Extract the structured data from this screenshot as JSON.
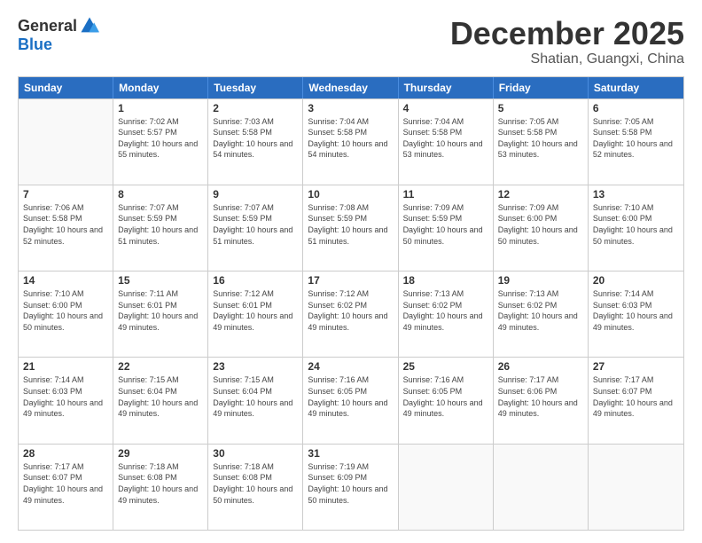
{
  "logo": {
    "general": "General",
    "blue": "Blue"
  },
  "header": {
    "month": "December 2025",
    "location": "Shatian, Guangxi, China"
  },
  "weekdays": [
    "Sunday",
    "Monday",
    "Tuesday",
    "Wednesday",
    "Thursday",
    "Friday",
    "Saturday"
  ],
  "weeks": [
    [
      {
        "day": "",
        "empty": true
      },
      {
        "day": "1",
        "sunrise": "7:02 AM",
        "sunset": "5:57 PM",
        "daylight": "10 hours and 55 minutes."
      },
      {
        "day": "2",
        "sunrise": "7:03 AM",
        "sunset": "5:58 PM",
        "daylight": "10 hours and 54 minutes."
      },
      {
        "day": "3",
        "sunrise": "7:04 AM",
        "sunset": "5:58 PM",
        "daylight": "10 hours and 54 minutes."
      },
      {
        "day": "4",
        "sunrise": "7:04 AM",
        "sunset": "5:58 PM",
        "daylight": "10 hours and 53 minutes."
      },
      {
        "day": "5",
        "sunrise": "7:05 AM",
        "sunset": "5:58 PM",
        "daylight": "10 hours and 53 minutes."
      },
      {
        "day": "6",
        "sunrise": "7:05 AM",
        "sunset": "5:58 PM",
        "daylight": "10 hours and 52 minutes."
      }
    ],
    [
      {
        "day": "7",
        "sunrise": "7:06 AM",
        "sunset": "5:58 PM",
        "daylight": "10 hours and 52 minutes."
      },
      {
        "day": "8",
        "sunrise": "7:07 AM",
        "sunset": "5:59 PM",
        "daylight": "10 hours and 51 minutes."
      },
      {
        "day": "9",
        "sunrise": "7:07 AM",
        "sunset": "5:59 PM",
        "daylight": "10 hours and 51 minutes."
      },
      {
        "day": "10",
        "sunrise": "7:08 AM",
        "sunset": "5:59 PM",
        "daylight": "10 hours and 51 minutes."
      },
      {
        "day": "11",
        "sunrise": "7:09 AM",
        "sunset": "5:59 PM",
        "daylight": "10 hours and 50 minutes."
      },
      {
        "day": "12",
        "sunrise": "7:09 AM",
        "sunset": "6:00 PM",
        "daylight": "10 hours and 50 minutes."
      },
      {
        "day": "13",
        "sunrise": "7:10 AM",
        "sunset": "6:00 PM",
        "daylight": "10 hours and 50 minutes."
      }
    ],
    [
      {
        "day": "14",
        "sunrise": "7:10 AM",
        "sunset": "6:00 PM",
        "daylight": "10 hours and 50 minutes."
      },
      {
        "day": "15",
        "sunrise": "7:11 AM",
        "sunset": "6:01 PM",
        "daylight": "10 hours and 49 minutes."
      },
      {
        "day": "16",
        "sunrise": "7:12 AM",
        "sunset": "6:01 PM",
        "daylight": "10 hours and 49 minutes."
      },
      {
        "day": "17",
        "sunrise": "7:12 AM",
        "sunset": "6:02 PM",
        "daylight": "10 hours and 49 minutes."
      },
      {
        "day": "18",
        "sunrise": "7:13 AM",
        "sunset": "6:02 PM",
        "daylight": "10 hours and 49 minutes."
      },
      {
        "day": "19",
        "sunrise": "7:13 AM",
        "sunset": "6:02 PM",
        "daylight": "10 hours and 49 minutes."
      },
      {
        "day": "20",
        "sunrise": "7:14 AM",
        "sunset": "6:03 PM",
        "daylight": "10 hours and 49 minutes."
      }
    ],
    [
      {
        "day": "21",
        "sunrise": "7:14 AM",
        "sunset": "6:03 PM",
        "daylight": "10 hours and 49 minutes."
      },
      {
        "day": "22",
        "sunrise": "7:15 AM",
        "sunset": "6:04 PM",
        "daylight": "10 hours and 49 minutes."
      },
      {
        "day": "23",
        "sunrise": "7:15 AM",
        "sunset": "6:04 PM",
        "daylight": "10 hours and 49 minutes."
      },
      {
        "day": "24",
        "sunrise": "7:16 AM",
        "sunset": "6:05 PM",
        "daylight": "10 hours and 49 minutes."
      },
      {
        "day": "25",
        "sunrise": "7:16 AM",
        "sunset": "6:05 PM",
        "daylight": "10 hours and 49 minutes."
      },
      {
        "day": "26",
        "sunrise": "7:17 AM",
        "sunset": "6:06 PM",
        "daylight": "10 hours and 49 minutes."
      },
      {
        "day": "27",
        "sunrise": "7:17 AM",
        "sunset": "6:07 PM",
        "daylight": "10 hours and 49 minutes."
      }
    ],
    [
      {
        "day": "28",
        "sunrise": "7:17 AM",
        "sunset": "6:07 PM",
        "daylight": "10 hours and 49 minutes."
      },
      {
        "day": "29",
        "sunrise": "7:18 AM",
        "sunset": "6:08 PM",
        "daylight": "10 hours and 49 minutes."
      },
      {
        "day": "30",
        "sunrise": "7:18 AM",
        "sunset": "6:08 PM",
        "daylight": "10 hours and 50 minutes."
      },
      {
        "day": "31",
        "sunrise": "7:19 AM",
        "sunset": "6:09 PM",
        "daylight": "10 hours and 50 minutes."
      },
      {
        "day": "",
        "empty": true
      },
      {
        "day": "",
        "empty": true
      },
      {
        "day": "",
        "empty": true
      }
    ]
  ],
  "labels": {
    "sunrise_prefix": "Sunrise: ",
    "sunset_prefix": "Sunset: ",
    "daylight_prefix": "Daylight: "
  }
}
